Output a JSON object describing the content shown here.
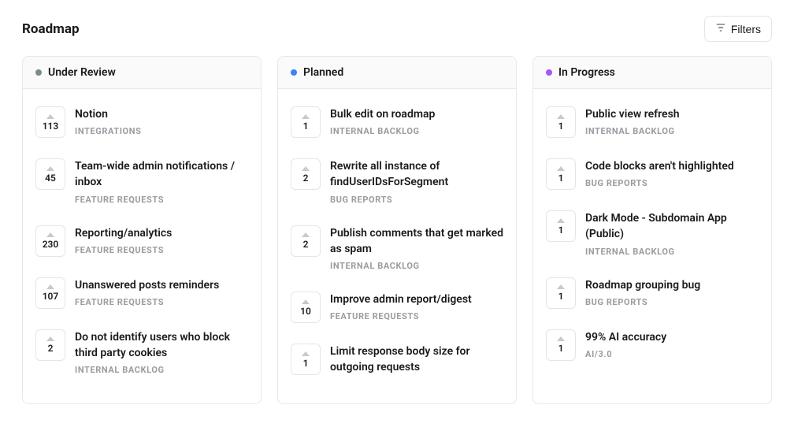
{
  "header": {
    "title": "Roadmap",
    "filters_label": "Filters"
  },
  "columns": [
    {
      "id": "under-review",
      "title": "Under Review",
      "dot_color": "#7b8a8b",
      "cards": [
        {
          "votes": 113,
          "title": "Notion",
          "category": "INTEGRATIONS"
        },
        {
          "votes": 45,
          "title": "Team-wide admin notifications / inbox",
          "category": "FEATURE REQUESTS"
        },
        {
          "votes": 230,
          "title": "Reporting/analytics",
          "category": "FEATURE REQUESTS"
        },
        {
          "votes": 107,
          "title": "Unanswered posts reminders",
          "category": "FEATURE REQUESTS"
        },
        {
          "votes": 2,
          "title": "Do not identify users who block third party cookies",
          "category": "INTERNAL BACKLOG"
        }
      ]
    },
    {
      "id": "planned",
      "title": "Planned",
      "dot_color": "#3b82f6",
      "cards": [
        {
          "votes": 1,
          "title": "Bulk edit on roadmap",
          "category": "INTERNAL BACKLOG"
        },
        {
          "votes": 2,
          "title": "Rewrite all instance of findUserIDsForSegment",
          "category": "BUG REPORTS"
        },
        {
          "votes": 2,
          "title": "Publish comments that get marked as spam",
          "category": "INTERNAL BACKLOG"
        },
        {
          "votes": 10,
          "title": "Improve admin report/digest",
          "category": "FEATURE REQUESTS"
        },
        {
          "votes": 1,
          "title": "Limit response body size for outgoing requests",
          "category": ""
        }
      ]
    },
    {
      "id": "in-progress",
      "title": "In Progress",
      "dot_color": "#a855f7",
      "cards": [
        {
          "votes": 1,
          "title": "Public view refresh",
          "category": "INTERNAL BACKLOG"
        },
        {
          "votes": 1,
          "title": "Code blocks aren't highlighted",
          "category": "BUG REPORTS"
        },
        {
          "votes": 1,
          "title": "Dark Mode - Subdomain App (Public)",
          "category": "INTERNAL BACKLOG"
        },
        {
          "votes": 1,
          "title": "Roadmap grouping bug",
          "category": "BUG REPORTS"
        },
        {
          "votes": 1,
          "title": "99% AI accuracy",
          "category": "AI/3.0"
        }
      ]
    }
  ]
}
